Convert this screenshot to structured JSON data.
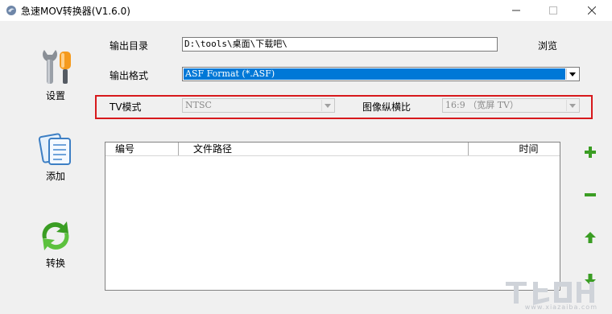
{
  "window": {
    "title": "急速MOV转换器(V1.6.0)",
    "min_glyph": "—",
    "max_glyph": "☐",
    "close_glyph": "✕"
  },
  "sidebar": {
    "items": [
      {
        "label": "设置",
        "icon": "wrench-settings-icon"
      },
      {
        "label": "添加",
        "icon": "add-documents-icon"
      },
      {
        "label": "转换",
        "icon": "convert-arrows-icon"
      }
    ]
  },
  "output": {
    "dir_label": "输出目录",
    "dir_value": "D:\\tools\\桌面\\下载吧\\",
    "browse_label": "浏览",
    "format_label": "输出格式",
    "format_value": "ASF Format (*.ASF)"
  },
  "options": {
    "tv_label": "TV模式",
    "tv_value": "NTSC",
    "aspect_label": "图像纵横比",
    "aspect_value": "16:9  （宽屏 TV）"
  },
  "file_list": {
    "columns": [
      "编号",
      "文件路径",
      "时间"
    ],
    "rows": []
  },
  "list_actions": [
    {
      "name": "add",
      "icon": "plus-icon"
    },
    {
      "name": "remove",
      "icon": "minus-icon"
    },
    {
      "name": "move-up",
      "icon": "arrow-up-icon"
    },
    {
      "name": "move-down",
      "icon": "arrow-down-icon"
    }
  ],
  "colors": {
    "accent": "#0078d7",
    "highlight_border": "#d7191c",
    "green_action": "#3a9d23"
  },
  "watermark": {
    "text": "www.xiazaiba.com"
  }
}
